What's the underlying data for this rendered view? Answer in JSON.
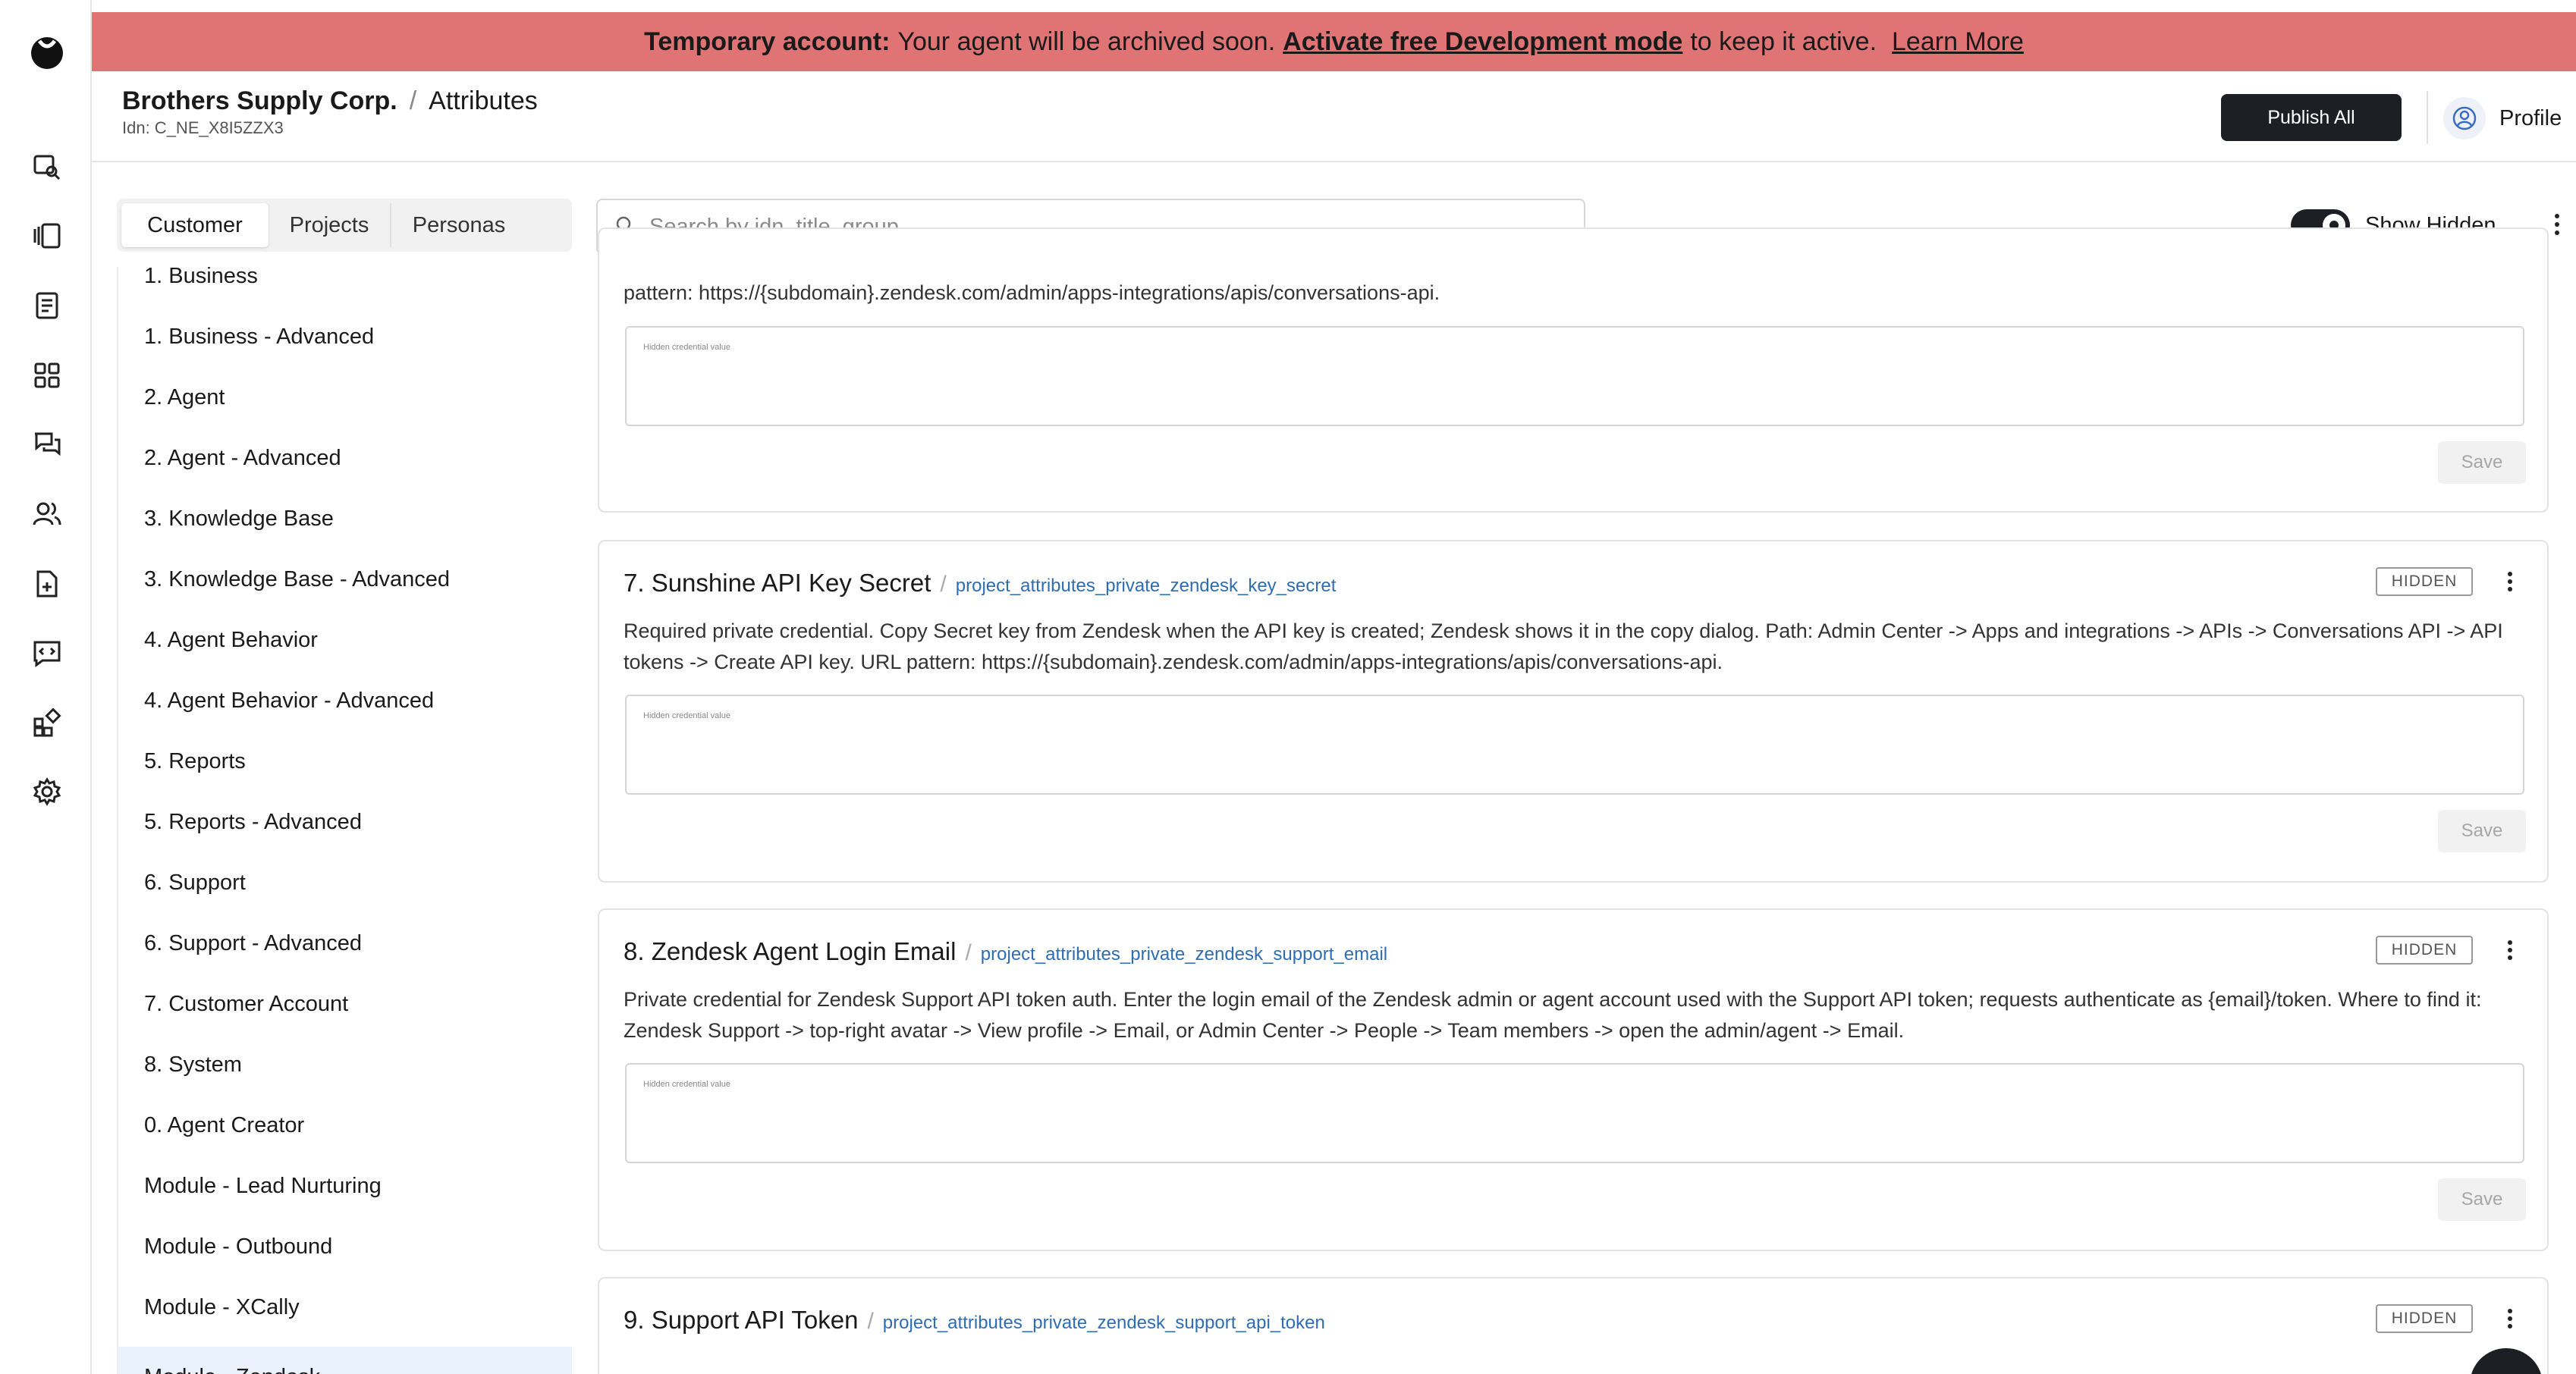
{
  "banner": {
    "bold": "Temporary account:",
    "text": "Your agent will be archived soon.",
    "link": "Activate free Development mode",
    "after": "to keep it active.",
    "learn": "Learn More"
  },
  "header": {
    "org": "Brothers Supply Corp.",
    "separator": "/",
    "page": "Attributes",
    "idn": "Idn: C_NE_X8I5ZZX3",
    "publish": "Publish All",
    "profile": "Profile"
  },
  "tabs": [
    "Customer",
    "Projects",
    "Personas"
  ],
  "search": {
    "placeholder": "Search by idn, title, group"
  },
  "show_hidden": {
    "label": "Show Hidden",
    "on": true
  },
  "sidebar": {
    "items": [
      "1. Business",
      "1. Business - Advanced",
      "2. Agent",
      "2. Agent - Advanced",
      "3. Knowledge Base",
      "3. Knowledge Base - Advanced",
      "4. Agent Behavior",
      "4. Agent Behavior - Advanced",
      "5. Reports",
      "5. Reports - Advanced",
      "6. Support",
      "6. Support - Advanced",
      "7. Customer Account",
      "8. System",
      "0. Agent Creator",
      "Module - Lead Nurturing",
      "Module - Outbound",
      "Module - XCally",
      "Module - Zendesk"
    ],
    "selected": "Module - Zendesk"
  },
  "cards": [
    {
      "desc": "pattern: https://{subdomain}.zendesk.com/admin/apps-integrations/apis/conversations-api.",
      "field": "Hidden credential value",
      "save": "Save"
    },
    {
      "title": "7. Sunshine API Key Secret",
      "key": "project_attributes_private_zendesk_key_secret",
      "badge": "HIDDEN",
      "desc": "Required private credential. Copy Secret key from Zendesk when the API key is created; Zendesk shows it in the copy dialog. Path: Admin Center -> Apps and integrations -> APIs -> Conversations API -> API tokens -> Create API key. URL pattern: https://{subdomain}.zendesk.com/admin/apps-integrations/apis/conversations-api.",
      "field": "Hidden credential value",
      "save": "Save"
    },
    {
      "title": "8. Zendesk Agent Login Email",
      "key": "project_attributes_private_zendesk_support_email",
      "badge": "HIDDEN",
      "desc": "Private credential for Zendesk Support API token auth. Enter the login email of the Zendesk admin or agent account used with the Support API token; requests authenticate as {email}/token. Where to find it: Zendesk Support -> top-right avatar -> View profile -> Email, or Admin Center -> People -> Team members -> open the admin/agent -> Email.",
      "field": "Hidden credential value",
      "save": "Save"
    },
    {
      "title": "9. Support API Token",
      "key": "project_attributes_private_zendesk_support_api_token",
      "badge": "HIDDEN"
    }
  ],
  "colors": {
    "banner": "#e07474",
    "primary_button": "#1d1f24",
    "link": "#2f6db3",
    "selected_row": "#eaf2fd"
  },
  "icons": [
    "logo-icon",
    "agents-icon",
    "panels-icon",
    "document-icon",
    "grid-icon",
    "chat-icon",
    "users-icon",
    "file-icon",
    "code-chat-icon",
    "integrations-icon",
    "settings-icon"
  ]
}
